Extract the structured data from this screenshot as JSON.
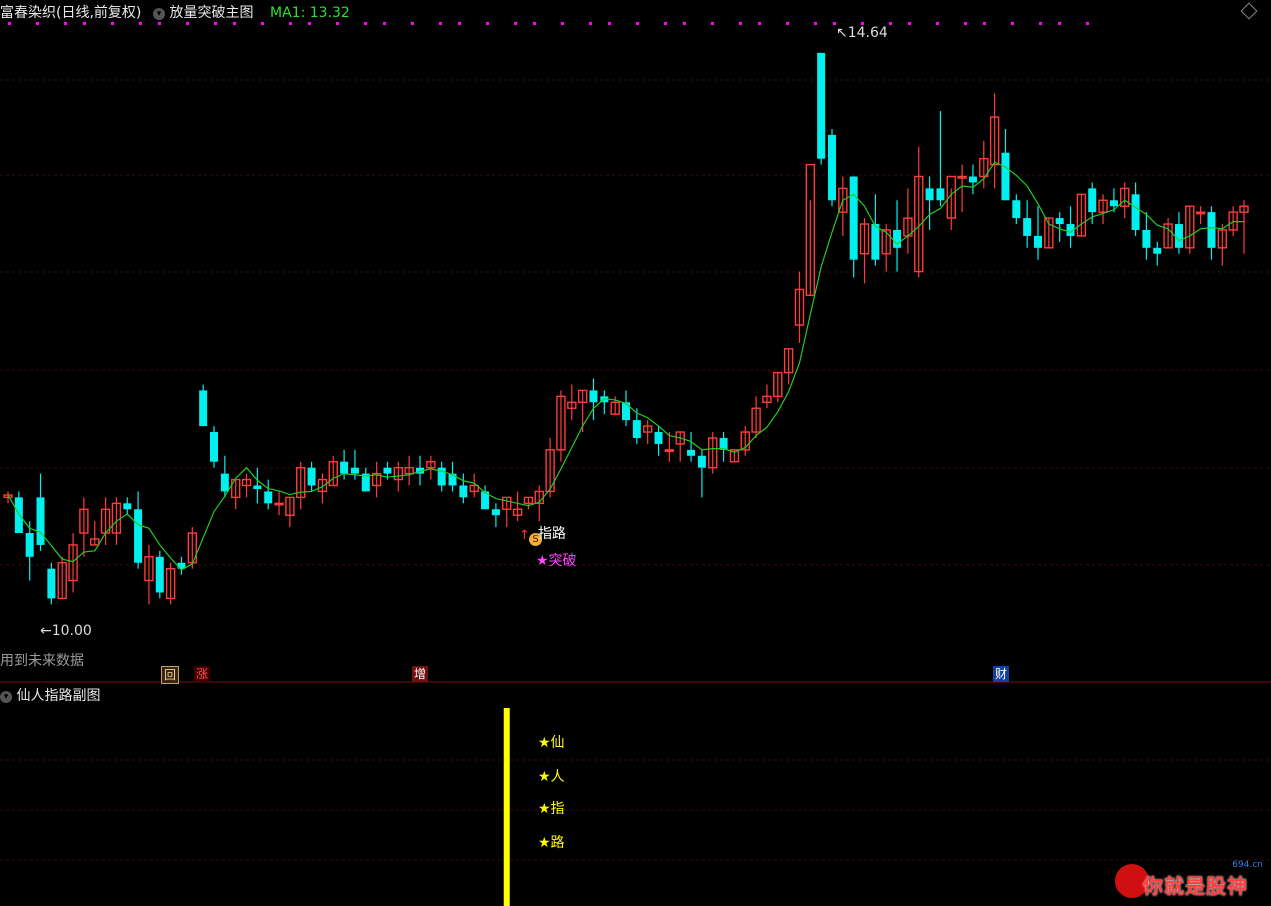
{
  "header": {
    "main_title": "富春染织(日线,前复权)",
    "indicator_name": "放量突破主图",
    "ma_readout": "MA1: 13.32"
  },
  "sub_panel": {
    "title": "仙人指路副图"
  },
  "annotations": {
    "high_label": "14.64",
    "low_label": "10.00",
    "future_data_note": "用到未来数据",
    "zhilu": "指路",
    "tupo": "★突破",
    "s_marker": "S"
  },
  "badges": {
    "hui": "回",
    "zhang": "涨",
    "zeng": "增",
    "cai": "财"
  },
  "sub_signals": [
    "★仙",
    "★人",
    "★指",
    "★路"
  ],
  "watermark": {
    "text": "你就是股神",
    "domain": "694.cn"
  },
  "colors": {
    "up": "#ff3b3b",
    "down": "#00f0f0",
    "ma": "#22cc22",
    "signal": "#ffff00",
    "dots": "#ff00ff"
  },
  "chart_data": {
    "type": "candlestick",
    "price_range": [
      9.7,
      14.9
    ],
    "high_marker": 14.64,
    "low_marker": 10.0,
    "signal_index": 46,
    "candles": [
      [
        10.9,
        10.95,
        10.85,
        10.92
      ],
      [
        10.9,
        10.95,
        10.7,
        10.6
      ],
      [
        10.6,
        10.7,
        10.2,
        10.4
      ],
      [
        10.9,
        11.1,
        10.45,
        10.5
      ],
      [
        10.3,
        10.35,
        10.0,
        10.05
      ],
      [
        10.05,
        10.4,
        10.05,
        10.35
      ],
      [
        10.2,
        10.6,
        10.1,
        10.5
      ],
      [
        10.6,
        10.9,
        10.4,
        10.8
      ],
      [
        10.5,
        10.7,
        10.5,
        10.55
      ],
      [
        10.6,
        10.9,
        10.5,
        10.8
      ],
      [
        10.6,
        10.9,
        10.5,
        10.85
      ],
      [
        10.85,
        10.9,
        10.75,
        10.8
      ],
      [
        10.8,
        10.95,
        10.3,
        10.35
      ],
      [
        10.2,
        10.5,
        10.0,
        10.4
      ],
      [
        10.4,
        10.45,
        10.05,
        10.1
      ],
      [
        10.05,
        10.35,
        10.0,
        10.3
      ],
      [
        10.35,
        10.4,
        10.25,
        10.3
      ],
      [
        10.35,
        10.65,
        10.3,
        10.6
      ],
      [
        11.8,
        11.85,
        11.5,
        11.5
      ],
      [
        11.45,
        11.5,
        11.15,
        11.2
      ],
      [
        11.1,
        11.25,
        10.9,
        10.95
      ],
      [
        10.9,
        11.05,
        10.8,
        11.05
      ],
      [
        11.0,
        11.1,
        10.9,
        11.05
      ],
      [
        11.0,
        11.15,
        10.85,
        10.97
      ],
      [
        10.95,
        11.05,
        10.8,
        10.85
      ],
      [
        10.85,
        10.95,
        10.75,
        10.85
      ],
      [
        10.75,
        10.9,
        10.65,
        10.9
      ],
      [
        10.9,
        11.2,
        10.8,
        11.15
      ],
      [
        11.15,
        11.2,
        10.95,
        11.0
      ],
      [
        10.95,
        11.1,
        10.85,
        11.05
      ],
      [
        11.0,
        11.25,
        11.0,
        11.2
      ],
      [
        11.2,
        11.3,
        11.05,
        11.1
      ],
      [
        11.15,
        11.3,
        11.05,
        11.1
      ],
      [
        11.1,
        11.15,
        10.95,
        10.95
      ],
      [
        11.0,
        11.2,
        10.9,
        11.1
      ],
      [
        11.15,
        11.2,
        11.05,
        11.1
      ],
      [
        11.05,
        11.2,
        10.95,
        11.15
      ],
      [
        11.1,
        11.25,
        11.0,
        11.15
      ],
      [
        11.15,
        11.25,
        11.0,
        11.1
      ],
      [
        11.15,
        11.25,
        11.05,
        11.2
      ],
      [
        11.15,
        11.2,
        10.95,
        11.0
      ],
      [
        11.1,
        11.2,
        10.95,
        11.0
      ],
      [
        11.0,
        11.1,
        10.85,
        10.9
      ],
      [
        10.95,
        11.1,
        10.9,
        11.0
      ],
      [
        10.95,
        11.0,
        10.8,
        10.8
      ],
      [
        10.8,
        10.85,
        10.65,
        10.75
      ],
      [
        10.8,
        10.9,
        10.65,
        10.9
      ],
      [
        10.75,
        10.95,
        10.7,
        10.8
      ],
      [
        10.85,
        10.9,
        10.8,
        10.9
      ],
      [
        10.85,
        11.0,
        10.7,
        10.95
      ],
      [
        10.95,
        11.4,
        10.9,
        11.3
      ],
      [
        11.3,
        11.8,
        11.2,
        11.75
      ],
      [
        11.65,
        11.85,
        11.55,
        11.7
      ],
      [
        11.7,
        11.8,
        11.45,
        11.8
      ],
      [
        11.8,
        11.9,
        11.55,
        11.7
      ],
      [
        11.75,
        11.8,
        11.6,
        11.7
      ],
      [
        11.6,
        11.75,
        11.6,
        11.7
      ],
      [
        11.7,
        11.8,
        11.5,
        11.55
      ],
      [
        11.55,
        11.65,
        11.35,
        11.4
      ],
      [
        11.45,
        11.55,
        11.35,
        11.5
      ],
      [
        11.45,
        11.5,
        11.25,
        11.35
      ],
      [
        11.3,
        11.45,
        11.2,
        11.3
      ],
      [
        11.35,
        11.45,
        11.2,
        11.45
      ],
      [
        11.3,
        11.45,
        11.2,
        11.25
      ],
      [
        11.25,
        11.3,
        10.9,
        11.15
      ],
      [
        11.15,
        11.45,
        11.1,
        11.4
      ],
      [
        11.4,
        11.45,
        11.2,
        11.3
      ],
      [
        11.2,
        11.3,
        11.2,
        11.3
      ],
      [
        11.3,
        11.5,
        11.25,
        11.45
      ],
      [
        11.45,
        11.75,
        11.4,
        11.65
      ],
      [
        11.7,
        11.85,
        11.65,
        11.75
      ],
      [
        11.75,
        11.95,
        11.7,
        11.95
      ],
      [
        11.95,
        12.15,
        11.85,
        12.15
      ],
      [
        12.35,
        12.8,
        12.2,
        12.65
      ],
      [
        12.6,
        13.4,
        12.6,
        13.7
      ],
      [
        14.64,
        14.64,
        13.7,
        13.75
      ],
      [
        13.95,
        14.0,
        13.35,
        13.4
      ],
      [
        13.3,
        13.6,
        13.1,
        13.5
      ],
      [
        13.6,
        13.6,
        12.75,
        12.9
      ],
      [
        12.95,
        13.25,
        12.7,
        13.2
      ],
      [
        13.2,
        13.45,
        12.85,
        12.9
      ],
      [
        12.95,
        13.2,
        12.8,
        13.15
      ],
      [
        13.15,
        13.4,
        12.8,
        13.0
      ],
      [
        13.1,
        13.5,
        12.95,
        13.25
      ],
      [
        12.8,
        13.85,
        12.75,
        13.6
      ],
      [
        13.5,
        13.6,
        13.15,
        13.4
      ],
      [
        13.5,
        14.15,
        13.35,
        13.4
      ],
      [
        13.25,
        13.5,
        13.15,
        13.6
      ],
      [
        13.6,
        13.7,
        13.3,
        13.6
      ],
      [
        13.6,
        13.7,
        13.45,
        13.55
      ],
      [
        13.6,
        13.9,
        13.5,
        13.75
      ],
      [
        13.7,
        14.3,
        13.5,
        14.1
      ],
      [
        13.8,
        14.0,
        13.4,
        13.4
      ],
      [
        13.4,
        13.45,
        13.2,
        13.25
      ],
      [
        13.25,
        13.4,
        13.0,
        13.1
      ],
      [
        13.1,
        13.35,
        12.9,
        13.0
      ],
      [
        13.0,
        13.25,
        13.0,
        13.25
      ],
      [
        13.25,
        13.3,
        13.05,
        13.2
      ],
      [
        13.2,
        13.35,
        13.0,
        13.1
      ],
      [
        13.1,
        13.45,
        13.1,
        13.45
      ],
      [
        13.5,
        13.55,
        13.2,
        13.3
      ],
      [
        13.3,
        13.45,
        13.2,
        13.4
      ],
      [
        13.4,
        13.5,
        13.3,
        13.35
      ],
      [
        13.35,
        13.55,
        13.25,
        13.5
      ],
      [
        13.45,
        13.55,
        13.1,
        13.15
      ],
      [
        13.15,
        13.3,
        12.9,
        13.0
      ],
      [
        13.0,
        13.05,
        12.85,
        12.95
      ],
      [
        13.0,
        13.25,
        13.0,
        13.2
      ],
      [
        13.2,
        13.3,
        12.95,
        13.0
      ],
      [
        13.0,
        13.35,
        12.95,
        13.35
      ],
      [
        13.3,
        13.35,
        13.2,
        13.3
      ],
      [
        13.3,
        13.35,
        12.9,
        13.0
      ],
      [
        13.0,
        13.2,
        12.85,
        13.15
      ],
      [
        13.15,
        13.35,
        13.1,
        13.3
      ],
      [
        13.3,
        13.4,
        12.95,
        13.35
      ]
    ]
  }
}
